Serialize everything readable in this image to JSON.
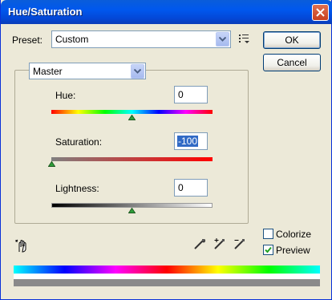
{
  "window": {
    "title": "Hue/Saturation"
  },
  "preset": {
    "label": "Preset:",
    "value": "Custom"
  },
  "buttons": {
    "ok": "OK",
    "cancel": "Cancel"
  },
  "channel": {
    "value": "Master"
  },
  "hue": {
    "label": "Hue:",
    "value": "0"
  },
  "saturation": {
    "label": "Saturation:",
    "value": "-100"
  },
  "lightness": {
    "label": "Lightness:",
    "value": "0"
  },
  "colorize": {
    "label": "Colorize",
    "checked": false
  },
  "preview": {
    "label": "Preview",
    "checked": true
  },
  "colors": {
    "titlebar": "#0058EE",
    "dialog_bg": "#ECE9D8",
    "selection": "#316AC5",
    "slider_thumb": "#2E9E3A"
  },
  "icons": [
    "close-icon",
    "chevron-down-icon",
    "options-menu-icon",
    "targeted-adjustment-hand-icon",
    "eyedropper-icon",
    "eyedropper-plus-icon",
    "eyedropper-minus-icon",
    "check-icon"
  ]
}
